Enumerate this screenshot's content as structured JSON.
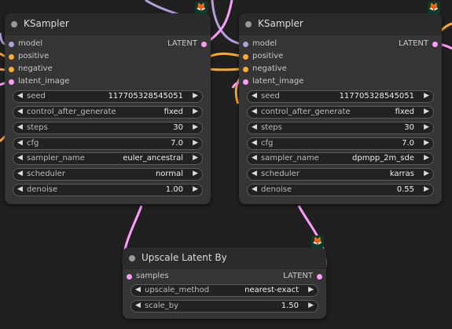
{
  "colors": {
    "background": "#202020",
    "node_body": "#353535",
    "node_header": "#2b2b2b",
    "model_slot": "#b39ddb",
    "conditioning_slot": "#ffa931",
    "latent_slot": "#ff9cf9",
    "badge_bg": "#0c3b2a"
  },
  "badge_icon": "fox-icon",
  "nodes": {
    "ksampler1": {
      "title": "KSampler",
      "inputs": [
        "model",
        "positive",
        "negative",
        "latent_image"
      ],
      "output": "LATENT",
      "widgets": [
        {
          "label": "seed",
          "value": "117705328545051"
        },
        {
          "label": "control_after_generate",
          "value": "fixed"
        },
        {
          "label": "steps",
          "value": "30"
        },
        {
          "label": "cfg",
          "value": "7.0"
        },
        {
          "label": "sampler_name",
          "value": "euler_ancestral"
        },
        {
          "label": "scheduler",
          "value": "normal"
        },
        {
          "label": "denoise",
          "value": "1.00"
        }
      ]
    },
    "ksampler2": {
      "title": "KSampler",
      "inputs": [
        "model",
        "positive",
        "negative",
        "latent_image"
      ],
      "output": "LATENT",
      "widgets": [
        {
          "label": "seed",
          "value": "117705328545051"
        },
        {
          "label": "control_after_generate",
          "value": "fixed"
        },
        {
          "label": "steps",
          "value": "30"
        },
        {
          "label": "cfg",
          "value": "7.0"
        },
        {
          "label": "sampler_name",
          "value": "dpmpp_2m_sde"
        },
        {
          "label": "scheduler",
          "value": "karras"
        },
        {
          "label": "denoise",
          "value": "0.55"
        }
      ]
    },
    "upscale": {
      "title": "Upscale Latent By",
      "inputs": [
        "samples"
      ],
      "output": "LATENT",
      "widgets": [
        {
          "label": "upscale_method",
          "value": "nearest-exact"
        },
        {
          "label": "scale_by",
          "value": "1.50"
        }
      ]
    }
  }
}
